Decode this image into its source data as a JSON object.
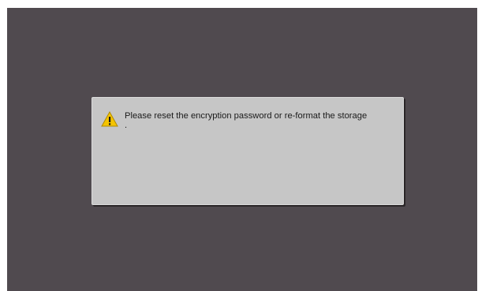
{
  "dialog": {
    "icon": "warning-icon",
    "message": "Please reset the encryption password or re-format the storage",
    "message_tail": "."
  },
  "colors": {
    "background": "#504a4f",
    "dialog": "#c6c6c6",
    "warning": "#f5c400"
  }
}
